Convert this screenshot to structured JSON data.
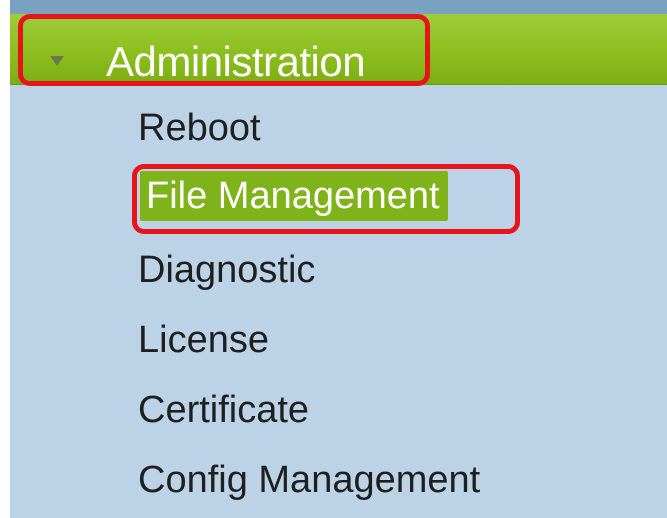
{
  "header": {
    "title": "Administration",
    "expand_icon": "triangle-down-icon",
    "accent_color": "#8cbf1e"
  },
  "menu": {
    "items": [
      {
        "label": "Reboot",
        "selected": false
      },
      {
        "label": "File Management",
        "selected": true
      },
      {
        "label": "Diagnostic",
        "selected": false
      },
      {
        "label": "License",
        "selected": false
      },
      {
        "label": "Certificate",
        "selected": false
      },
      {
        "label": "Config Management",
        "selected": false
      }
    ]
  },
  "colors": {
    "panel_background": "#bcd3e7",
    "selected_background": "#7fb31a",
    "annotation_border": "#e8141c"
  }
}
